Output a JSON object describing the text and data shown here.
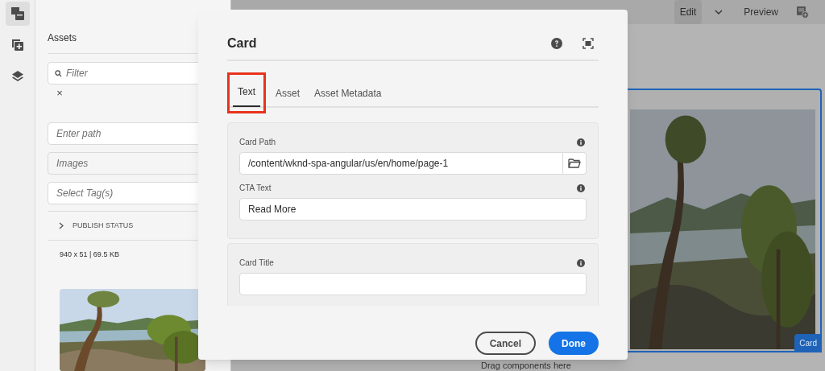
{
  "rail": {
    "items": [
      {
        "kind": "assets",
        "selected": true
      },
      {
        "kind": "components",
        "selected": false
      },
      {
        "kind": "layers",
        "selected": false
      }
    ]
  },
  "assets_panel": {
    "title": "Assets",
    "filter": {
      "placeholder": "Filter"
    },
    "clear": "×",
    "fields": [
      {
        "kind": "text",
        "placeholder": "Enter path"
      },
      {
        "kind": "select",
        "placeholder": "Images"
      },
      {
        "kind": "text",
        "placeholder": "Select Tag(s)"
      }
    ],
    "publish_status": {
      "label": "PUBLISH STATUS",
      "expanded": false
    },
    "asset_info": "940 x 51 | 69.5 KB"
  },
  "editor": {
    "toolbar": {
      "edit": "Edit",
      "preview": "Preview"
    },
    "component": {
      "badge": "Card"
    },
    "drop_zone": "Drag components here"
  },
  "dialog": {
    "title": "Card",
    "tabs": [
      {
        "label": "Text",
        "selected": true,
        "highlighted": true
      },
      {
        "label": "Asset",
        "selected": false,
        "highlighted": false
      },
      {
        "label": "Asset Metadata",
        "selected": false,
        "highlighted": false
      }
    ],
    "sections": [
      {
        "fields": [
          {
            "label": "Card Path",
            "value": "/content/wknd-spa-angular/us/en/home/page-1",
            "kind": "path"
          },
          {
            "label": "CTA Text",
            "value": "Read More",
            "kind": "text"
          }
        ]
      },
      {
        "fields": [
          {
            "label": "Card Title",
            "kind": "text"
          }
        ]
      }
    ],
    "buttons": [
      {
        "label": "Cancel",
        "kind": "secondary"
      },
      {
        "label": "Done",
        "kind": "primary"
      }
    ]
  }
}
